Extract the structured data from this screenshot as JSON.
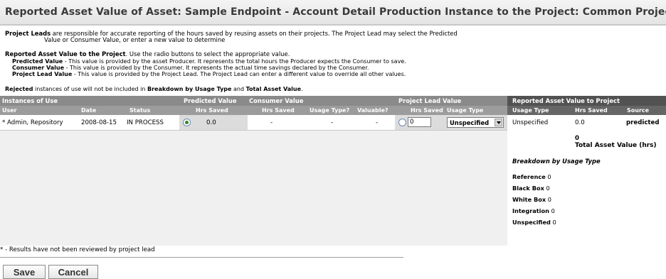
{
  "header": {
    "title": "Reported Asset Value of Asset: Sample Endpoint - Account Detail Production Instance to the Project: Common Project"
  },
  "intro": {
    "leads_label": "Project Leads",
    "leads_text1": "are responsible for accurate reporting of the hours saved by reusing assets on their projects. The Project Lead may select the Predicted",
    "leads_text2": "Value or Consumer Value, or enter a new value to determine",
    "rav_label": "Reported Asset Value to the Project",
    "rav_text": ". Use the radio buttons to select the appropriate value.",
    "predicted_label": "Predicted Value",
    "predicted_text": " - This value is provided by the asset Producer. It represents the total hours the Producer expects the Consumer to save.",
    "consumer_label": "Consumer Value",
    "consumer_text": " - This value is provided by the Consumer. It represents the actual time savings declared by the Consumer.",
    "lead_label": "Project Lead Value",
    "lead_text": " - This value is provided by the Project Lead. The Project Lead can enter a different value to override all other values.",
    "rejected_label": "Rejected",
    "rejected_text1": " instances of use will not be included in ",
    "rejected_bold1": "Breakdown by Usage Type",
    "rejected_and": " and ",
    "rejected_bold2": "Total Asset Value",
    "rejected_end": "."
  },
  "table": {
    "groups": {
      "instances": "Instances of Use",
      "predicted": "Predicted Value",
      "consumer": "Consumer Value",
      "lead": "Project Lead Value",
      "reported": "Reported Asset Value to Project"
    },
    "columns": {
      "user": "User",
      "date": "Date",
      "status": "Status",
      "pred_hrs": "Hrs Saved",
      "cons_hrs": "Hrs Saved",
      "cons_usage": "Usage Type?",
      "cons_valuable": "Valuable?",
      "lead_hrs": "Hrs Saved",
      "lead_usage": "Usage Type",
      "rep_usage": "Usage Type",
      "rep_hrs": "Hrs Saved",
      "rep_source": "Source"
    },
    "row": {
      "user": "* Admin, Repository",
      "date": "2008-08-15",
      "status": "IN PROCESS",
      "pred_hrs": "0.0",
      "cons_hrs": "-",
      "cons_usage": "-",
      "cons_valuable": "-",
      "lead_hrs_value": "0",
      "lead_usage_selected": "Unspecified",
      "rep_usage": "Unspecified",
      "rep_hrs": "0.0",
      "rep_source": "predicted"
    }
  },
  "summary": {
    "total_value": "0",
    "total_label": "Total Asset Value (hrs)",
    "breakdown_title": "Breakdown by Usage Type",
    "items": [
      {
        "label": "Reference",
        "value": "0"
      },
      {
        "label": "Black Box",
        "value": "0"
      },
      {
        "label": "White Box",
        "value": "0"
      },
      {
        "label": "Integration",
        "value": "0"
      },
      {
        "label": "Unspecified",
        "value": "0"
      }
    ]
  },
  "footnote": "* - Results have not been reviewed by project lead",
  "buttons": {
    "save": "Save",
    "cancel": "Cancel"
  }
}
